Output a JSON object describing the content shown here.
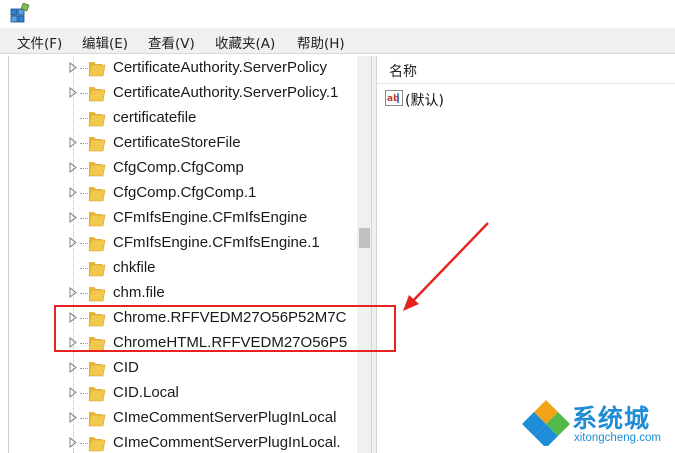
{
  "menu": [
    "文件(F)",
    "编辑(E)",
    "查看(V)",
    "收藏夹(A)",
    "帮助(H)"
  ],
  "tree": {
    "items": [
      {
        "label": "CertificateAuthority.ServerPolicy",
        "expandable": true
      },
      {
        "label": "CertificateAuthority.ServerPolicy.1",
        "expandable": true
      },
      {
        "label": "certificatefile",
        "expandable": false
      },
      {
        "label": "CertificateStoreFile",
        "expandable": true
      },
      {
        "label": "CfgComp.CfgComp",
        "expandable": true
      },
      {
        "label": "CfgComp.CfgComp.1",
        "expandable": true
      },
      {
        "label": "CFmIfsEngine.CFmIfsEngine",
        "expandable": true
      },
      {
        "label": "CFmIfsEngine.CFmIfsEngine.1",
        "expandable": true
      },
      {
        "label": "chkfile",
        "expandable": false
      },
      {
        "label": "chm.file",
        "expandable": true
      },
      {
        "label": "Chrome.RFFVEDM27O56P52M7C",
        "expandable": true
      },
      {
        "label": "ChromeHTML.RFFVEDM27O56P5",
        "expandable": true
      },
      {
        "label": "CID",
        "expandable": true
      },
      {
        "label": "CID.Local",
        "expandable": true
      },
      {
        "label": "CImeCommentServerPlugInLocal",
        "expandable": true
      },
      {
        "label": "CImeCommentServerPlugInLocal.",
        "expandable": true
      }
    ]
  },
  "values": {
    "column_name": "名称",
    "rows": [
      {
        "name": "(默认)",
        "icon": "string-value-icon"
      }
    ]
  },
  "watermark": {
    "text": "系统城",
    "url": "xitongcheng.com"
  },
  "colors": {
    "highlight": "#e8221f",
    "arrow": "#e8221f",
    "folder": "#f2c94c",
    "watermark": "#1f8dd6"
  }
}
